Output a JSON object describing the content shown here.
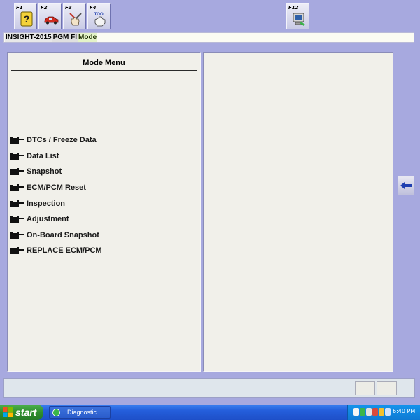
{
  "toolbar": {
    "keys": [
      {
        "label": "F1",
        "icon": "help-icon"
      },
      {
        "label": "F2",
        "icon": "car-icon"
      },
      {
        "label": "F3",
        "icon": "hand-tools-icon"
      },
      {
        "label": "F4",
        "icon": "tool-hand-icon",
        "icon_text": "TOOL"
      },
      {
        "label": "F12",
        "icon": "computer-icon"
      }
    ]
  },
  "mode_bar": {
    "model": "INSIGHT-2015",
    "system": "PGM FI",
    "mode": "Mode"
  },
  "left_panel": {
    "title": "Mode Menu",
    "items": [
      {
        "label": "DTCs / Freeze Data",
        "icon": "pointing-hand-icon"
      },
      {
        "label": "Data List",
        "icon": "pointing-hand-icon"
      },
      {
        "label": "Snapshot",
        "icon": "pointing-hand-icon"
      },
      {
        "label": "ECM/PCM Reset",
        "icon": "pointing-hand-icon"
      },
      {
        "label": "Inspection",
        "icon": "pointing-hand-icon"
      },
      {
        "label": "Adjustment",
        "icon": "pointing-hand-icon"
      },
      {
        "label": "On-Board Snapshot",
        "icon": "pointing-hand-icon"
      },
      {
        "label": "REPLACE ECM/PCM",
        "icon": "pointing-hand-icon"
      }
    ]
  },
  "back_button": {
    "icon": "arrow-left-icon"
  },
  "taskbar": {
    "start_label": "start",
    "task_label": "Diagnostic ...",
    "clock": "6:40 PM"
  },
  "colors": {
    "background": "#A7A9DF",
    "panel": "#F1F0EA",
    "taskbar": "#245EDB",
    "start": "#2F8F2F"
  }
}
